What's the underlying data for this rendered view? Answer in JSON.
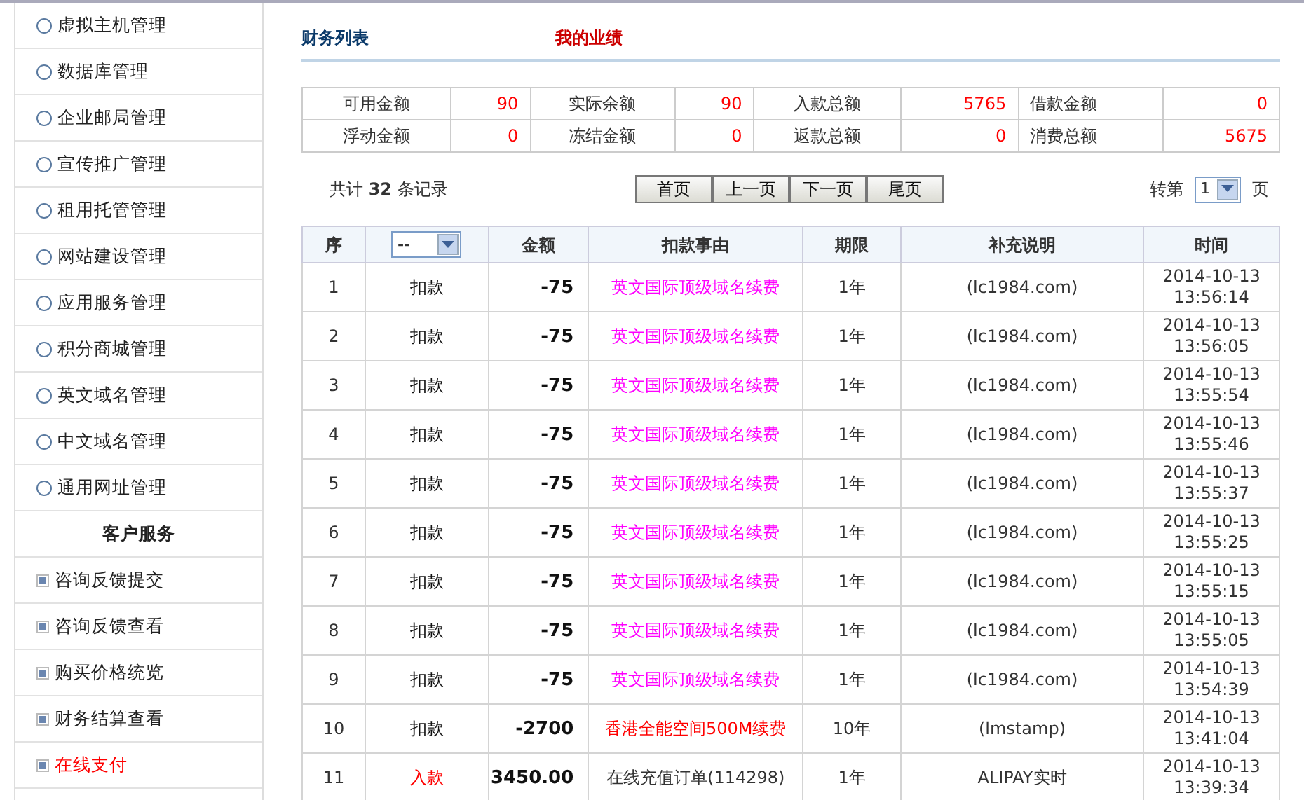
{
  "sidebar": {
    "items": [
      {
        "label": "虚拟主机管理",
        "kind": "circle",
        "selected": false
      },
      {
        "label": "数据库管理",
        "kind": "circle",
        "selected": false
      },
      {
        "label": "企业邮局管理",
        "kind": "circle",
        "selected": false
      },
      {
        "label": "宣传推广管理",
        "kind": "circle",
        "selected": false
      },
      {
        "label": "租用托管管理",
        "kind": "circle",
        "selected": false
      },
      {
        "label": "网站建设管理",
        "kind": "circle",
        "selected": false
      },
      {
        "label": "应用服务管理",
        "kind": "circle",
        "selected": false
      },
      {
        "label": "积分商城管理",
        "kind": "circle",
        "selected": false
      },
      {
        "label": "英文域名管理",
        "kind": "circle",
        "selected": false
      },
      {
        "label": "中文域名管理",
        "kind": "circle",
        "selected": false
      },
      {
        "label": "通用网址管理",
        "kind": "circle",
        "selected": false
      },
      {
        "label": "客户服务",
        "kind": "heading",
        "selected": false
      },
      {
        "label": "咨询反馈提交",
        "kind": "square",
        "selected": false
      },
      {
        "label": "咨询反馈查看",
        "kind": "square",
        "selected": false
      },
      {
        "label": "购买价格统览",
        "kind": "square",
        "selected": false
      },
      {
        "label": "财务结算查看",
        "kind": "square",
        "selected": false
      },
      {
        "label": "在线支付",
        "kind": "square",
        "selected": true
      }
    ]
  },
  "tabs": [
    {
      "label": "财务列表",
      "selected": true
    },
    {
      "label": "我的业绩",
      "selected": false
    }
  ],
  "summary": [
    [
      {
        "label": "可用金额",
        "value": "90"
      },
      {
        "label": "实际余额",
        "value": "90"
      },
      {
        "label": "入款总额",
        "value": "5765"
      },
      {
        "label": "借款金额",
        "value": "0"
      }
    ],
    [
      {
        "label": "浮动金额",
        "value": "0"
      },
      {
        "label": "冻结金额",
        "value": "0"
      },
      {
        "label": "返款总额",
        "value": "0"
      },
      {
        "label": "消费总额",
        "value": "5675"
      }
    ]
  ],
  "record_count": "共计 **32** 条记录",
  "pager_buttons": [
    "首页",
    "上一页",
    "下一页",
    "尾页"
  ],
  "goto": {
    "prefix": "转第",
    "value": "1",
    "suffix": "页"
  },
  "table": {
    "columns": [
      "序",
      "",
      "金额",
      "扣款事由",
      "期限",
      "补充说明",
      "时间"
    ],
    "filter_value": "--",
    "rows": [
      {
        "no": "1",
        "type": {
          "text": "扣款",
          "kind": "debit"
        },
        "amount": "-75",
        "reason": {
          "text": "英文国际顶级域名续费",
          "color": "#ff00ff"
        },
        "term": "1年",
        "note": "(lc1984.com)",
        "date": "2014-10-13",
        "time": "13:56:14"
      },
      {
        "no": "2",
        "type": {
          "text": "扣款",
          "kind": "debit"
        },
        "amount": "-75",
        "reason": {
          "text": "英文国际顶级域名续费",
          "color": "#ff00ff"
        },
        "term": "1年",
        "note": "(lc1984.com)",
        "date": "2014-10-13",
        "time": "13:56:05"
      },
      {
        "no": "3",
        "type": {
          "text": "扣款",
          "kind": "debit"
        },
        "amount": "-75",
        "reason": {
          "text": "英文国际顶级域名续费",
          "color": "#ff00ff"
        },
        "term": "1年",
        "note": "(lc1984.com)",
        "date": "2014-10-13",
        "time": "13:55:54"
      },
      {
        "no": "4",
        "type": {
          "text": "扣款",
          "kind": "debit"
        },
        "amount": "-75",
        "reason": {
          "text": "英文国际顶级域名续费",
          "color": "#ff00ff"
        },
        "term": "1年",
        "note": "(lc1984.com)",
        "date": "2014-10-13",
        "time": "13:55:46"
      },
      {
        "no": "5",
        "type": {
          "text": "扣款",
          "kind": "debit"
        },
        "amount": "-75",
        "reason": {
          "text": "英文国际顶级域名续费",
          "color": "#ff00ff"
        },
        "term": "1年",
        "note": "(lc1984.com)",
        "date": "2014-10-13",
        "time": "13:55:37"
      },
      {
        "no": "6",
        "type": {
          "text": "扣款",
          "kind": "debit"
        },
        "amount": "-75",
        "reason": {
          "text": "英文国际顶级域名续费",
          "color": "#ff00ff"
        },
        "term": "1年",
        "note": "(lc1984.com)",
        "date": "2014-10-13",
        "time": "13:55:25"
      },
      {
        "no": "7",
        "type": {
          "text": "扣款",
          "kind": "debit"
        },
        "amount": "-75",
        "reason": {
          "text": "英文国际顶级域名续费",
          "color": "#ff00ff"
        },
        "term": "1年",
        "note": "(lc1984.com)",
        "date": "2014-10-13",
        "time": "13:55:15"
      },
      {
        "no": "8",
        "type": {
          "text": "扣款",
          "kind": "debit"
        },
        "amount": "-75",
        "reason": {
          "text": "英文国际顶级域名续费",
          "color": "#ff00ff"
        },
        "term": "1年",
        "note": "(lc1984.com)",
        "date": "2014-10-13",
        "time": "13:55:05"
      },
      {
        "no": "9",
        "type": {
          "text": "扣款",
          "kind": "debit"
        },
        "amount": "-75",
        "reason": {
          "text": "英文国际顶级域名续费",
          "color": "#ff00ff"
        },
        "term": "1年",
        "note": "(lc1984.com)",
        "date": "2014-10-13",
        "time": "13:54:39"
      },
      {
        "no": "10",
        "type": {
          "text": "扣款",
          "kind": "debit"
        },
        "amount": "-2700",
        "reason": {
          "text": "香港全能空间500M续费",
          "color": "#ff0000"
        },
        "term": "10年",
        "note": "(lmstamp)",
        "date": "2014-10-13",
        "time": "13:41:04"
      },
      {
        "no": "11",
        "type": {
          "text": "入款",
          "kind": "credit"
        },
        "amount": "3450.00",
        "reason": {
          "text": "在线充值订单(114298)",
          "color": "#333333"
        },
        "term": "1年",
        "note": "ALIPAY实时",
        "date": "2014-10-13",
        "time": "13:39:34"
      }
    ]
  }
}
